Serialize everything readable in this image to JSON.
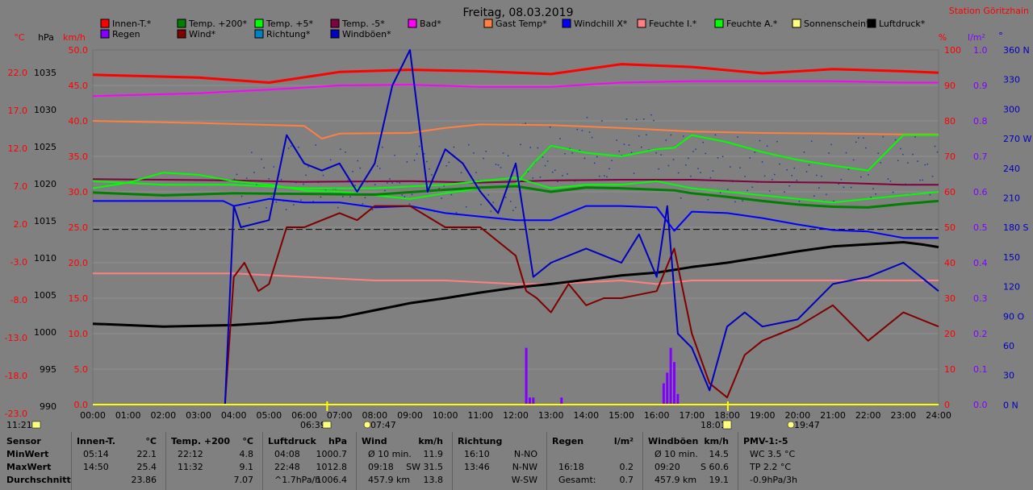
{
  "title": "Freitag, 08.03.2019",
  "station": "Station Göritzhain",
  "units": {
    "tempC": "°C",
    "hPa": "hPa",
    "kmh": "km/h",
    "pct": "%",
    "lm2": "l/m²",
    "deg": "°"
  },
  "legend": [
    {
      "label": "Innen-T.*",
      "color": "#ff0000"
    },
    {
      "label": "Regen",
      "color": "#8000ff"
    },
    {
      "label": "Temp. +200*",
      "color": "#008000"
    },
    {
      "label": "Wind*",
      "color": "#800000"
    },
    {
      "label": "Temp. +5*",
      "color": "#00ff00"
    },
    {
      "label": "Richtung*",
      "color": "#0080c0"
    },
    {
      "label": "Temp. -5*",
      "color": "#800040"
    },
    {
      "label": "Windböen*",
      "color": "#0000c0"
    },
    {
      "label": "Bad*",
      "color": "#ff00ff"
    },
    {
      "label": "Gast Temp*",
      "color": "#ff8040"
    },
    {
      "label": "Windchill X*",
      "color": "#0000ff"
    },
    {
      "label": "Feuchte I.*",
      "color": "#ff8080"
    },
    {
      "label": "Feuchte A.*",
      "color": "#00ff00"
    },
    {
      "label": "Sonnenschein*",
      "color": "#ffff80"
    },
    {
      "label": "Luftdruck*",
      "color": "#000000"
    }
  ],
  "bottom_labels": {
    "left_time": "11:21",
    "sunrise": "06:39",
    "moonrise": "07:47",
    "sunset": "18:01",
    "moonset": "19:47"
  },
  "chart_data": {
    "type": "line",
    "x_ticks": [
      "00:00",
      "01:00",
      "02:00",
      "03:00",
      "04:00",
      "05:00",
      "06:00",
      "07:00",
      "08:00",
      "09:00",
      "10:00",
      "11:00",
      "12:00",
      "13:00",
      "14:00",
      "15:00",
      "16:00",
      "17:00",
      "18:00",
      "19:00",
      "20:00",
      "21:00",
      "22:00",
      "23:00",
      "24:00"
    ],
    "axes": {
      "temp_c": [
        "22.0",
        "17.0",
        "12.0",
        "7.0",
        "2.0",
        "-3.0",
        "-8.0",
        "-13.0",
        "-18.0",
        "-23.0"
      ],
      "pressure_hpa": [
        "1035",
        "1030",
        "1025",
        "1020",
        "1015",
        "1010",
        "1005",
        "1000",
        "995",
        "990"
      ],
      "wind_kmh": [
        "50.0",
        "45.0",
        "40.0",
        "35.0",
        "30.0",
        "25.0",
        "20.0",
        "15.0",
        "10.0",
        "5.0",
        "0.0"
      ],
      "humidity_pct": [
        "100",
        "90",
        "80",
        "70",
        "60",
        "50",
        "40",
        "30",
        "20",
        "10",
        "0"
      ],
      "rain_lm2": [
        "1.0",
        "0.9",
        "0.8",
        "0.7",
        "0.6",
        "0.5",
        "0.4",
        "0.3",
        "0.2",
        "0.1",
        "0.0"
      ],
      "direction": [
        "360 N",
        "330",
        "300",
        "270 W",
        "240",
        "210",
        "180 S",
        "150",
        "120",
        "90 O",
        "60",
        "30",
        "0 N"
      ]
    },
    "y_range_kmh": [
      0,
      50
    ],
    "series": [
      {
        "name": "Innen-T.*",
        "color": "#ff0000",
        "axis": "temp",
        "t": [
          0,
          3,
          5,
          7,
          9,
          11,
          13,
          15,
          17,
          19,
          21,
          23,
          24
        ],
        "v": [
          23.5,
          23.1,
          22.4,
          23.9,
          24.2,
          24.0,
          23.6,
          25.0,
          24.6,
          23.7,
          24.3,
          24.0,
          23.8
        ]
      },
      {
        "name": "Bad*",
        "color": "#ff00ff",
        "axis": "temp",
        "t": [
          0,
          3,
          5,
          7,
          9,
          11,
          13,
          15,
          17,
          19,
          21,
          23,
          24
        ],
        "v": [
          20.5,
          20.9,
          21.4,
          22.0,
          22.1,
          21.8,
          21.8,
          22.4,
          22.6,
          22.6,
          22.6,
          22.4,
          22.4
        ]
      },
      {
        "name": "Gast Temp*",
        "color": "#ff8040",
        "axis": "temp",
        "t": [
          0,
          3,
          6,
          6.5,
          7,
          9,
          10,
          11,
          13,
          15,
          17,
          19,
          21,
          23,
          24
        ],
        "v": [
          17.0,
          16.7,
          16.3,
          14.5,
          15.2,
          15.3,
          16.0,
          16.5,
          16.4,
          16.0,
          15.5,
          15.3,
          15.2,
          15.1,
          15.1
        ]
      },
      {
        "name": "Temp. -5*",
        "color": "#800040",
        "axis": "temp",
        "t": [
          0,
          4,
          6,
          9,
          11,
          13,
          15,
          17,
          19,
          21,
          23,
          24
        ],
        "v": [
          8.8,
          8.6,
          8.4,
          8.5,
          8.3,
          8.6,
          8.7,
          8.7,
          8.4,
          8.3,
          8.0,
          8.0
        ]
      },
      {
        "name": "Temp. +5*",
        "color": "#00ff00",
        "axis": "temp",
        "t": [
          0,
          1,
          2,
          3,
          4,
          5,
          6,
          7,
          8,
          9,
          10,
          11,
          12,
          12.5,
          13,
          14,
          15,
          16,
          16.5,
          17,
          18,
          19,
          20,
          21,
          22,
          23,
          24
        ],
        "v": [
          7.5,
          8.3,
          9.7,
          9.4,
          8.5,
          8.0,
          7.2,
          7.0,
          6.5,
          6.0,
          6.8,
          7.5,
          8.0,
          11.0,
          13.5,
          12.5,
          12.0,
          13.0,
          13.2,
          15.0,
          14.0,
          12.6,
          11.5,
          10.7,
          10.0,
          15.0,
          15.0
        ]
      },
      {
        "name": "Temp. +200*",
        "color": "#008000",
        "axis": "temp",
        "t": [
          0,
          2,
          4,
          6,
          8,
          10,
          11,
          12,
          13,
          14,
          15,
          16,
          16.5,
          17,
          18,
          19,
          20,
          21,
          22,
          23,
          24
        ],
        "v": [
          6.9,
          6.5,
          6.8,
          6.7,
          6.6,
          7.3,
          7.6,
          7.8,
          7.0,
          7.6,
          7.5,
          7.3,
          7.2,
          6.8,
          6.3,
          5.7,
          5.2,
          4.9,
          4.8,
          5.3,
          5.7
        ]
      },
      {
        "name": "Feuchte A.*",
        "color": "#00ff00",
        "axis": "pct",
        "t": [
          0,
          2,
          4,
          6,
          8,
          10,
          11,
          12,
          13,
          14,
          15,
          16,
          16.5,
          17,
          18,
          19,
          20,
          21,
          22,
          23,
          24
        ],
        "v": [
          63,
          62,
          62,
          61,
          61,
          62,
          63,
          64,
          61,
          62,
          62,
          63,
          62,
          61,
          60,
          59,
          58,
          57,
          58,
          59,
          60
        ]
      },
      {
        "name": "Feuchte I.*",
        "color": "#ff8080",
        "axis": "pct",
        "t": [
          0,
          4,
          6,
          8,
          10,
          12,
          13,
          15,
          16,
          17,
          18,
          20,
          22,
          24
        ],
        "v": [
          37,
          37,
          36,
          35,
          35,
          34,
          34,
          35,
          34,
          35,
          35,
          35,
          35,
          35
        ]
      },
      {
        "name": "Windchill X*",
        "color": "#0000ff",
        "axis": "temp",
        "t": [
          0,
          3.7,
          4,
          5,
          6,
          7,
          8,
          9,
          10,
          11,
          12,
          13,
          14,
          15,
          16,
          16.5,
          17,
          18,
          19,
          20,
          21,
          22,
          23,
          24
        ],
        "v": [
          5.7,
          5.7,
          5.0,
          6.0,
          5.5,
          5.5,
          4.8,
          5.0,
          4.0,
          3.5,
          3.0,
          3.0,
          5.0,
          5.0,
          4.8,
          1.5,
          4.2,
          4.0,
          3.3,
          2.4,
          1.6,
          1.4,
          0.5,
          0.5
        ]
      },
      {
        "name": "Luftdruck*",
        "color": "#000000",
        "axis": "hPa",
        "t": [
          0,
          2,
          4,
          5,
          6,
          7,
          8,
          9,
          10,
          11,
          12,
          13,
          14,
          15,
          16,
          17,
          18,
          19,
          20,
          21,
          22,
          23,
          23.5,
          24
        ],
        "v": [
          1001.4,
          1001.0,
          1001.2,
          1001.5,
          1002.0,
          1002.3,
          1003.3,
          1004.3,
          1005.0,
          1005.8,
          1006.5,
          1007.0,
          1007.6,
          1008.2,
          1008.6,
          1009.4,
          1010.0,
          1010.8,
          1011.6,
          1012.3,
          1012.6,
          1012.9,
          1012.6,
          1012.2
        ]
      },
      {
        "name": "Wind*",
        "color": "#800000",
        "axis": "kmh",
        "t": [
          0,
          3.75,
          4,
          4.3,
          4.7,
          5,
          5.5,
          6,
          7,
          7.5,
          8,
          9,
          10,
          11,
          12,
          12.3,
          12.6,
          13,
          13.5,
          14,
          14.5,
          15,
          16,
          16.5,
          17,
          17.5,
          18,
          18.5,
          19,
          20,
          21,
          22,
          23,
          24
        ],
        "v": [
          0,
          0,
          18,
          20,
          16,
          17,
          25,
          25,
          27,
          26,
          28,
          28,
          25,
          25,
          21,
          16,
          15,
          13,
          17,
          14,
          15,
          15,
          16,
          22,
          10,
          3,
          1,
          7,
          9,
          11,
          14,
          9,
          13,
          11
        ]
      },
      {
        "name": "Windböen*",
        "color": "#0000c0",
        "axis": "kmh",
        "t": [
          0,
          3.75,
          4,
          4.2,
          5,
          5.5,
          6,
          6.5,
          7,
          7.5,
          8,
          8.5,
          9,
          9.5,
          10,
          10.5,
          11,
          11.5,
          12,
          12.5,
          13,
          14,
          15,
          15.5,
          16,
          16.3,
          16.6,
          17,
          17.5,
          18,
          18.5,
          19,
          20,
          21,
          22,
          23,
          24
        ],
        "v": [
          0,
          0,
          28,
          25,
          26,
          38,
          34,
          33,
          34,
          30,
          34,
          45,
          50,
          30,
          36,
          34,
          30,
          27,
          34,
          18,
          20,
          22,
          20,
          24,
          18,
          28,
          10,
          8,
          2,
          11,
          13,
          11,
          12,
          17,
          18,
          20,
          16
        ]
      }
    ],
    "rain_bars": [
      {
        "t": 12.3,
        "v": 0.16
      },
      {
        "t": 12.4,
        "v": 0.02
      },
      {
        "t": 12.5,
        "v": 0.02
      },
      {
        "t": 13.3,
        "v": 0.02
      },
      {
        "t": 16.2,
        "v": 0.06
      },
      {
        "t": 16.3,
        "v": 0.09
      },
      {
        "t": 16.4,
        "v": 0.16
      },
      {
        "t": 16.5,
        "v": 0.12
      },
      {
        "t": 16.6,
        "v": 0.03
      }
    ]
  },
  "stats": {
    "row_labels": [
      "Sensor",
      "MinWert",
      "MaxWert",
      "Durchschnitt"
    ],
    "sections": [
      {
        "title": "Innen-T.",
        "unit": "°C",
        "rows": [
          [
            "05:14",
            "22.1"
          ],
          [
            "14:50",
            "25.4"
          ],
          [
            "",
            "23.86"
          ]
        ]
      },
      {
        "title": "Temp. +200",
        "unit": "°C",
        "rows": [
          [
            "22:12",
            "4.8"
          ],
          [
            "11:32",
            "9.1"
          ],
          [
            "",
            "7.07"
          ]
        ]
      },
      {
        "title": "Luftdruck",
        "unit": "hPa",
        "rows": [
          [
            "04:08",
            "1000.7"
          ],
          [
            "22:48",
            "1012.8"
          ],
          [
            "^1.7hPa/h",
            "1006.4"
          ]
        ]
      },
      {
        "title": "Wind",
        "unit": "km/h",
        "rows": [
          [
            "Ø 10 min.",
            "11.9"
          ],
          [
            "09:18",
            "SW 31.5"
          ],
          [
            "457.9 km",
            "13.8"
          ]
        ]
      },
      {
        "title": "Richtung",
        "unit": "",
        "rows": [
          [
            "16:10",
            "N-NO"
          ],
          [
            "13:46",
            "N-NW"
          ],
          [
            "",
            "W-SW"
          ]
        ]
      },
      {
        "title": "Regen",
        "unit": "l/m²",
        "rows": [
          [
            "",
            ""
          ],
          [
            "16:18",
            "0.2"
          ],
          [
            "Gesamt:",
            "0.7"
          ]
        ]
      },
      {
        "title": "Windböen",
        "unit": "km/h",
        "rows": [
          [
            "Ø 10 min.",
            "14.5"
          ],
          [
            "09:20",
            "S 60.6"
          ],
          [
            "457.9 km",
            "19.1"
          ]
        ]
      },
      {
        "title": "PMV-1:-5",
        "unit": "",
        "rows": [
          [
            "WC 3.5 °C",
            ""
          ],
          [
            "TP 2.2 °C",
            ""
          ],
          [
            "-0.9hPa/3h",
            ""
          ]
        ]
      }
    ]
  }
}
